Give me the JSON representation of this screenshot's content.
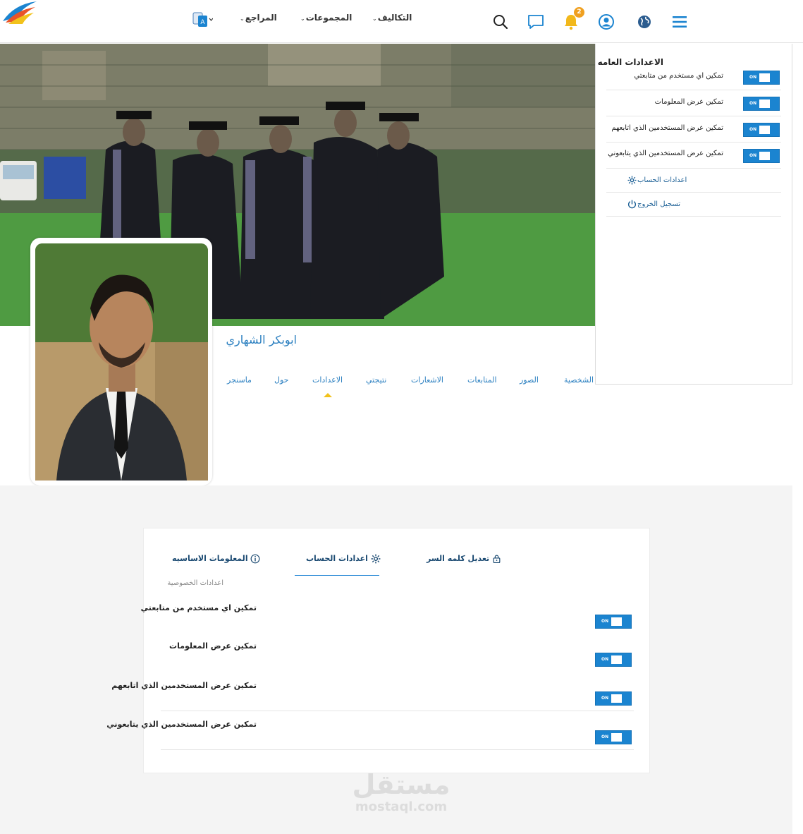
{
  "topnav": {
    "menus": [
      {
        "id": "costs",
        "label": "التكاليف"
      },
      {
        "id": "groups",
        "label": "المجموعات"
      },
      {
        "id": "references",
        "label": "المراجع"
      }
    ],
    "notification_count": "2",
    "icons": [
      "translate-icon",
      "search-icon",
      "chat-icon",
      "bell-icon",
      "user-icon",
      "globe-icon",
      "hamburger-menu-icon"
    ]
  },
  "profile": {
    "name": "ابوبكر الشهاري",
    "tabs": [
      {
        "id": "personal",
        "label": "الشخصية"
      },
      {
        "id": "photos",
        "label": "الصور"
      },
      {
        "id": "follows",
        "label": "المتابعات"
      },
      {
        "id": "notifications",
        "label": "الاشعارات"
      },
      {
        "id": "results",
        "label": "نتيجتي"
      },
      {
        "id": "settings",
        "label": "الاعدادات"
      },
      {
        "id": "about",
        "label": "حول"
      },
      {
        "id": "messenger",
        "label": "ماسنجر"
      }
    ],
    "active_tab": "الاعدادات"
  },
  "dropdown": {
    "title": "الاعدادات العامه",
    "toggles": [
      {
        "label": "تمكين اي مستخدم من متابعتي",
        "state": "ON"
      },
      {
        "label": "تمكين عرض المعلومات",
        "state": "ON"
      },
      {
        "label": "تمكين عرض المستخدمين الذي اتابعهم",
        "state": "ON"
      },
      {
        "label": "تمكين عرض المستخدمين الذي يتابعوني",
        "state": "ON"
      }
    ],
    "account_settings": "اعدادات الحساب",
    "logout": "تسجيل الخروج"
  },
  "settings_card": {
    "tabs": {
      "basic_info": "المعلومات الاساسيه",
      "account_settings": "اعدادات الحساب",
      "change_password": "تعديل كلمه السر"
    },
    "active_tab": "اعدادات الحساب",
    "section_label": "اعدادات الخصوصية",
    "rows": [
      {
        "label": "تمكين اي مستخدم من متابعتي",
        "state": "ON"
      },
      {
        "label": "تمكين عرض المعلومات",
        "state": "ON"
      },
      {
        "label": "تمكين عرض المستخدمين الذي اتابعهم",
        "state": "ON"
      },
      {
        "label": "تمكين عرض المستخدمين الذي يتابعوني",
        "state": "ON"
      }
    ]
  },
  "watermark": {
    "arabic": "مستقل",
    "latin": "mostaql.com"
  },
  "colors": {
    "accent": "#2a7fc0",
    "toggle": "#1b84d0",
    "badge": "#f0a020",
    "tab_marker": "#f2c21b"
  }
}
